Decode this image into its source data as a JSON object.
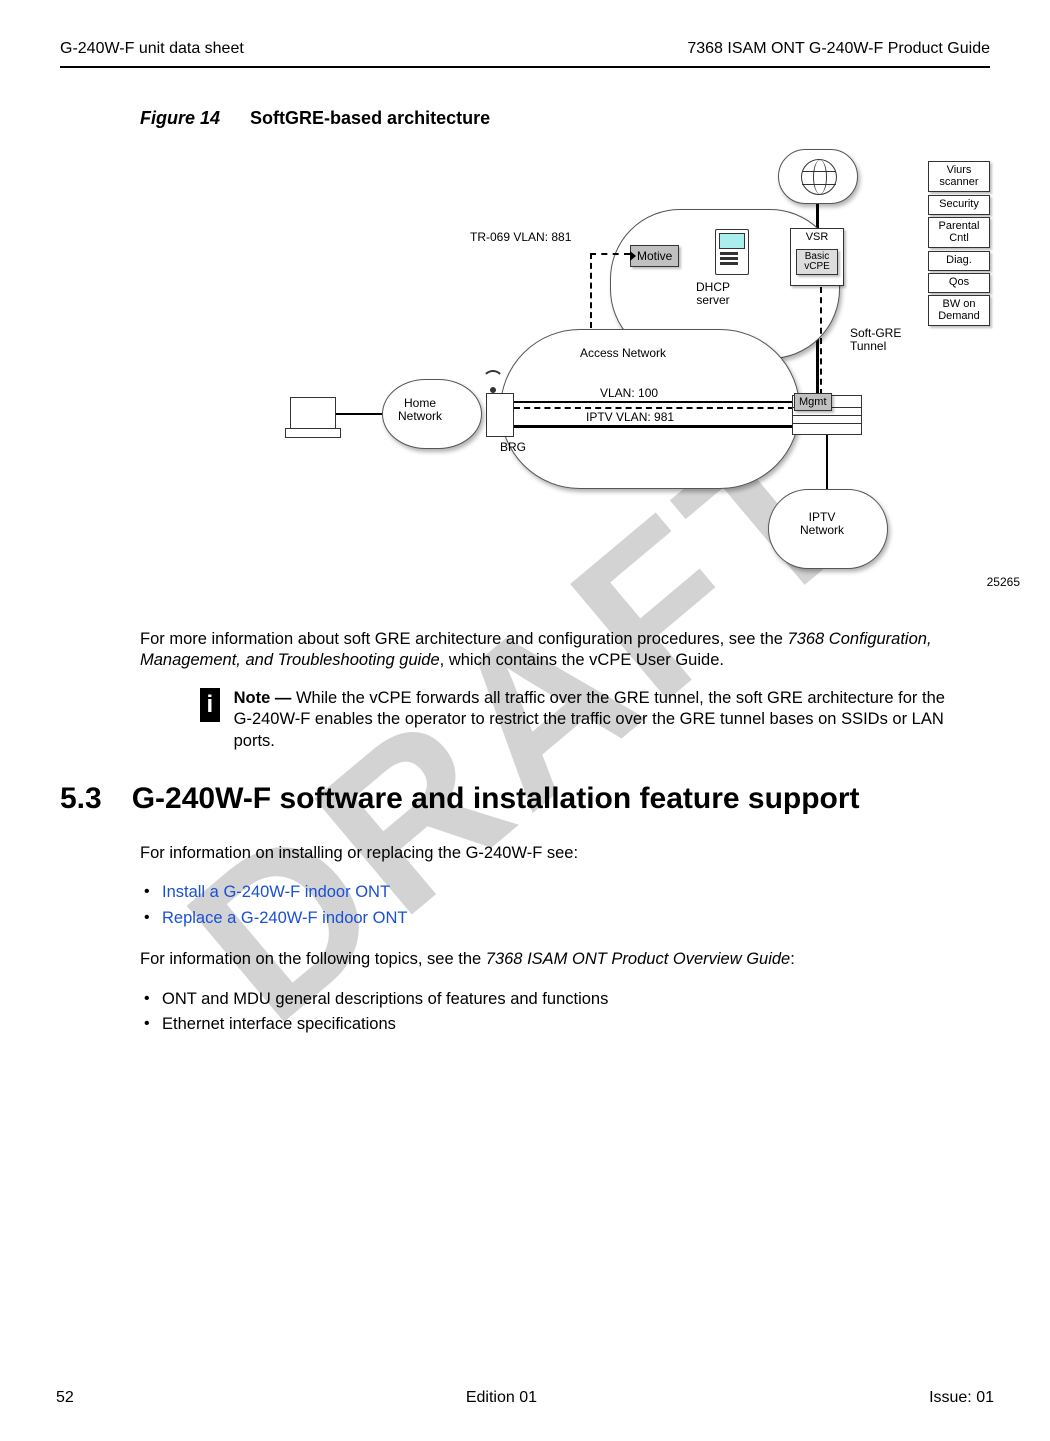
{
  "header": {
    "left": "G-240W-F unit data sheet",
    "right": "7368 ISAM ONT G-240W-F Product Guide"
  },
  "watermark": "DRAFT",
  "figure": {
    "caption_label": "Figure 14",
    "caption_title": "SoftGRE-based architecture",
    "id": "25265",
    "labels": {
      "tr069": "TR-069 VLAN: 881",
      "motive": "Motive",
      "dhcp": "DHCP\nserver",
      "access_network": "Access Network",
      "home_network": "Home\nNetwork",
      "brg": "BRG",
      "vlan100": "VLAN: 100",
      "iptv_vlan": "IPTV VLAN: 981",
      "mgmt": "Mgmt",
      "soft_gre": "Soft-GRE\nTunnel",
      "iptv_net": "IPTV\nNetwork",
      "vsr": "VSR",
      "basic_vcpe": "Basic\nvCPE"
    },
    "sideboxes": [
      "Viurs\nscanner",
      "Security",
      "Parental\nCntl",
      "Diag.",
      "Qos",
      "BW on\nDemand"
    ]
  },
  "para1_a": "For more information about soft GRE architecture and configuration procedures, see the ",
  "para1_ital": "7368 Configuration, Management, and Troubleshooting guide",
  "para1_b": ", which contains the vCPE User Guide.",
  "note": {
    "lead": "Note — ",
    "body": " While the vCPE forwards all traffic over the GRE tunnel, the soft GRE architecture for the G-240W-F enables the operator to restrict the traffic over the GRE tunnel bases on SSIDs or LAN ports."
  },
  "section": {
    "num": "5.3",
    "title": "G-240W-F software and installation feature support"
  },
  "para2": "For information on installing or replacing the G-240W-F see:",
  "links": [
    "Install a G-240W-F indoor ONT",
    "Replace a G-240W-F indoor ONT"
  ],
  "para3_a": "For information on the following topics, see the ",
  "para3_ital": "7368 ISAM ONT Product Overview Guide",
  "para3_b": ":",
  "bullets2": [
    "ONT and MDU general descriptions of features and functions",
    "Ethernet interface specifications"
  ],
  "footer": {
    "left": "52",
    "center": "Edition 01",
    "right": "Issue: 01"
  }
}
